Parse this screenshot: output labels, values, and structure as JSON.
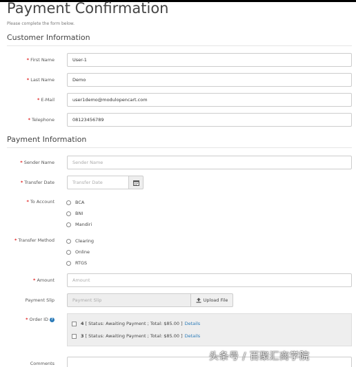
{
  "page": {
    "title": "Payment Confirmation",
    "subtitle": "Please complete the form below."
  },
  "customer_info": {
    "heading": "Customer Information",
    "first_name": {
      "label": "First Name",
      "value": "User-1"
    },
    "last_name": {
      "label": "Last Name",
      "value": "Demo"
    },
    "email": {
      "label": "E-Mail",
      "value": "user1demo@modulopencart.com"
    },
    "telephone": {
      "label": "Telephone",
      "value": "08123456789"
    }
  },
  "payment_info": {
    "heading": "Payment Information",
    "sender_name": {
      "label": "Sender Name",
      "placeholder": "Sender Name"
    },
    "transfer_date": {
      "label": "Transfer Date",
      "placeholder": "Transfer Date"
    },
    "to_account": {
      "label": "To Account",
      "options": [
        "BCA",
        "BNI",
        "Mandiri"
      ]
    },
    "transfer_method": {
      "label": "Transfer Method",
      "options": [
        "Clearing",
        "Online",
        "RTGS"
      ]
    },
    "amount": {
      "label": "Amount",
      "placeholder": "Amount"
    },
    "payment_slip": {
      "label": "Payment Slip",
      "placeholder": "Payment Slip",
      "button": "Upload File"
    },
    "order_id": {
      "label": "Order ID",
      "orders": [
        {
          "number": "4",
          "text": "[ Status: Awaiting Payment ; Total: $85.00 ]",
          "link": "Details"
        },
        {
          "number": "3",
          "text": "[ Status: Awaiting Payment ; Total: $85.00 ]",
          "link": "Details"
        }
      ]
    },
    "comments": {
      "label": "Comments"
    }
  },
  "watermark": "头条号 / 百聚汇商学院",
  "colors": {
    "required": "#e02020",
    "link": "#2a7ab8"
  }
}
